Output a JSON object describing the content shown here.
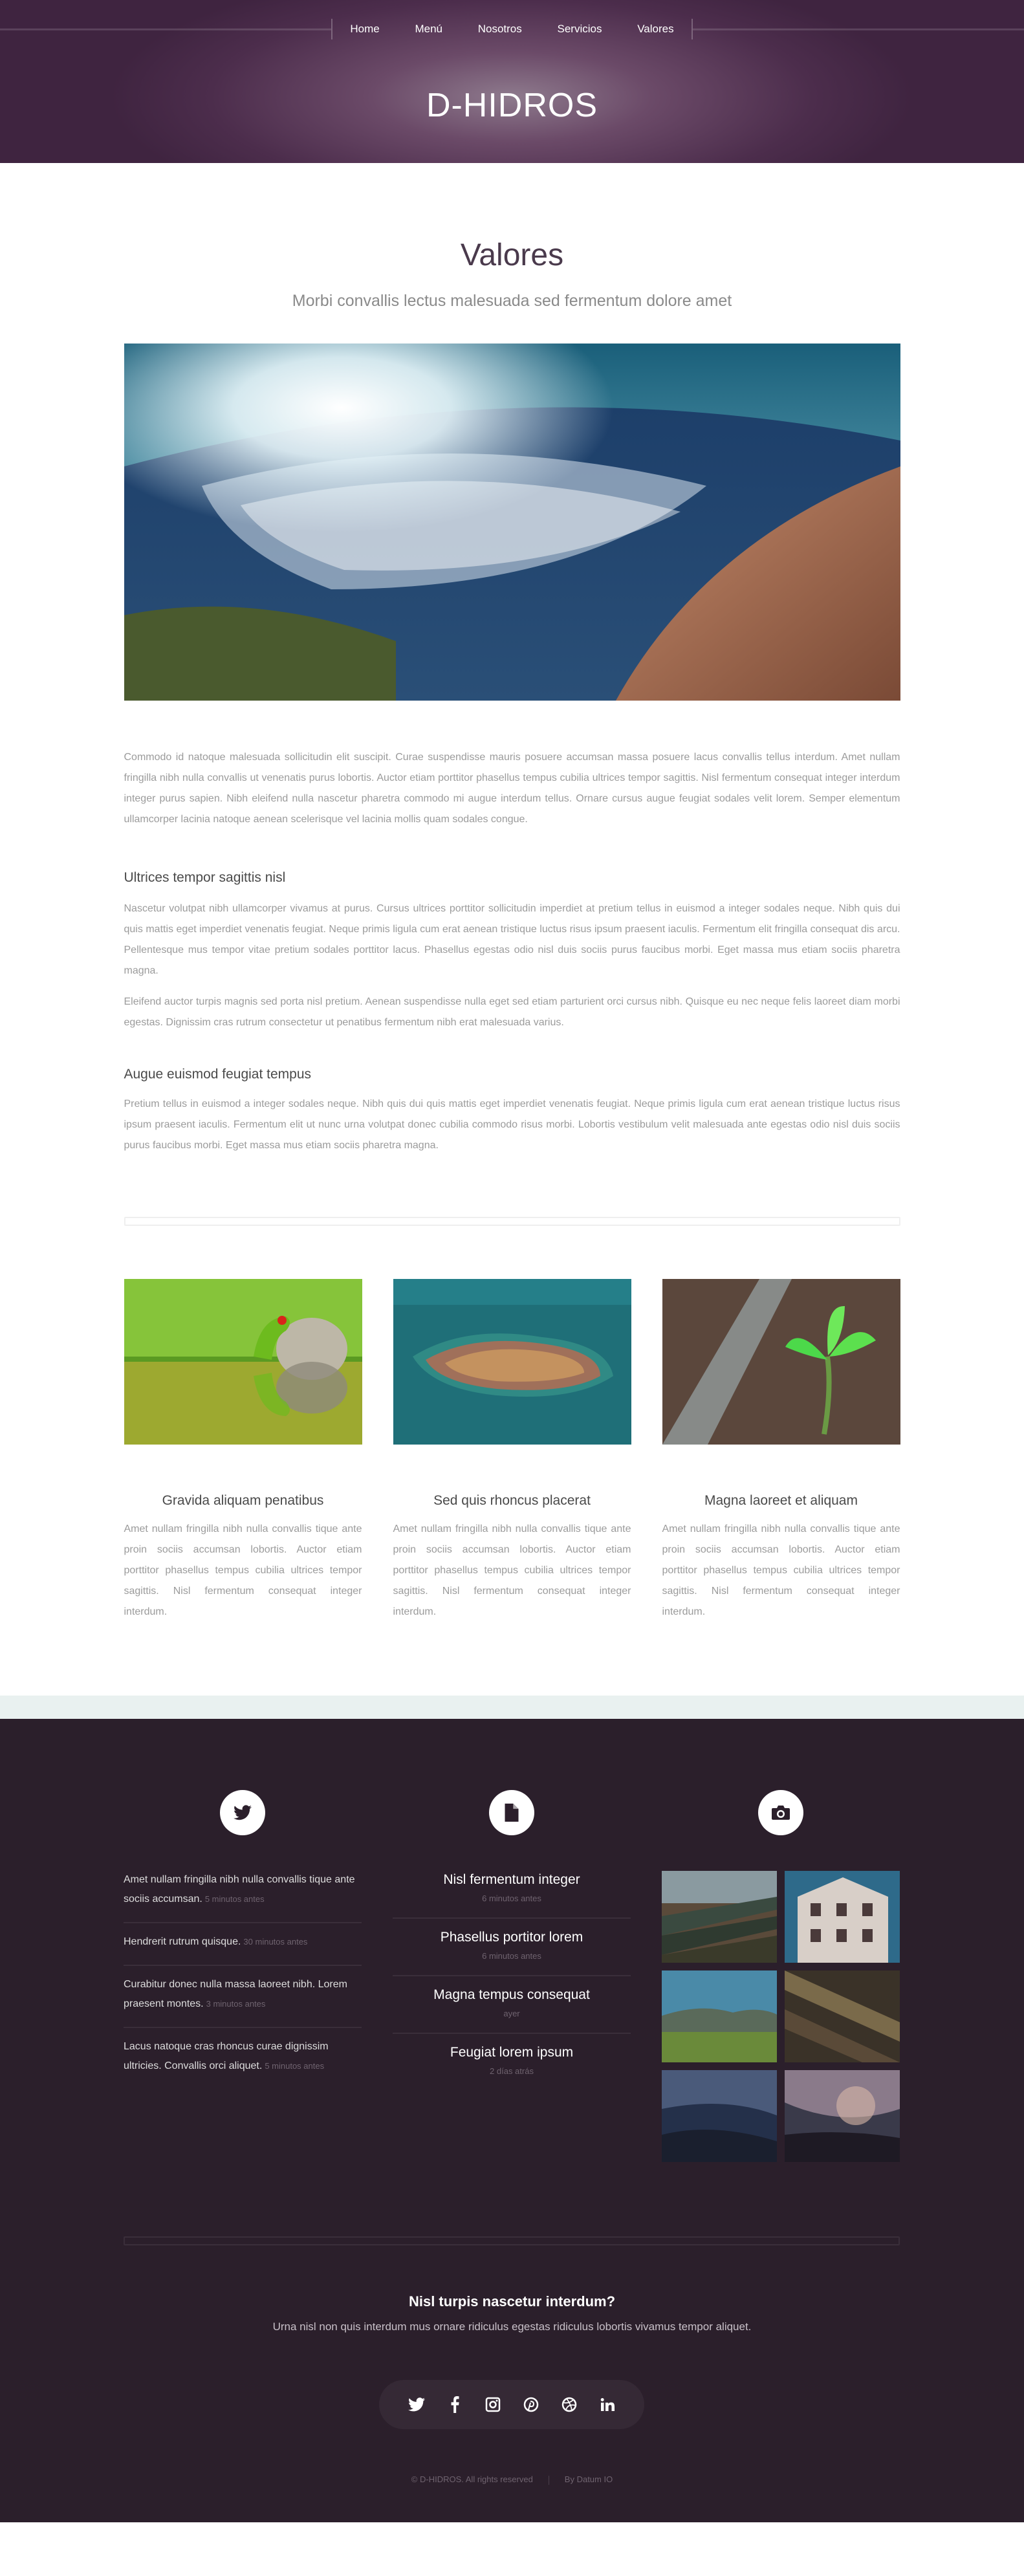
{
  "nav": {
    "items": [
      "Home",
      "Menú",
      "Nosotros",
      "Servicios",
      "Valores"
    ]
  },
  "site": {
    "title": "D-HIDROS"
  },
  "page": {
    "title": "Valores",
    "subtitle": "Morbi convallis lectus malesuada sed fermentum dolore amet"
  },
  "content": {
    "p1": "Commodo id natoque malesuada sollicitudin elit suscipit. Curae suspendisse mauris posuere accumsan massa posuere lacus convallis tellus interdum. Amet nullam fringilla nibh nulla convallis ut venenatis purus lobortis. Auctor etiam porttitor phasellus tempus cubilia ultrices tempor sagittis. Nisl fermentum consequat integer interdum integer purus sapien. Nibh eleifend nulla nascetur pharetra commodo mi augue interdum tellus. Ornare cursus augue feugiat sodales velit lorem. Semper elementum ullamcorper lacinia natoque aenean scelerisque vel lacinia mollis quam sodales congue.",
    "h1": "Ultrices tempor sagittis nisl",
    "p2": "Nascetur volutpat nibh ullamcorper vivamus at purus. Cursus ultrices porttitor sollicitudin imperdiet at pretium tellus in euismod a integer sodales neque. Nibh quis dui quis mattis eget imperdiet venenatis feugiat. Neque primis ligula cum erat aenean tristique luctus risus ipsum praesent iaculis. Fermentum elit fringilla consequat dis arcu. Pellentesque mus tempor vitae pretium sodales porttitor lacus. Phasellus egestas odio nisl duis sociis purus faucibus morbi. Eget massa mus etiam sociis pharetra magna.",
    "p3": "Eleifend auctor turpis magnis sed porta nisl pretium. Aenean suspendisse nulla eget sed etiam parturient orci cursus nibh. Quisque eu nec neque felis laoreet diam morbi egestas. Dignissim cras rutrum consectetur ut penatibus fermentum nibh erat malesuada varius.",
    "h2": "Augue euismod feugiat tempus",
    "p4": "Pretium tellus in euismod a integer sodales neque. Nibh quis dui quis mattis eget imperdiet venenatis feugiat. Neque primis ligula cum erat aenean tristique luctus risus ipsum praesent iaculis. Fermentum elit ut nunc urna volutpat donec cubilia commodo risus morbi. Lobortis vestibulum velit malesuada ante egestas odio nisl duis sociis purus faucibus morbi. Eget massa mus etiam sociis pharetra magna."
  },
  "features": [
    {
      "title": "Gravida aliquam penatibus",
      "text": "Amet nullam fringilla nibh nulla convallis tique ante proin sociis accumsan lobortis. Auctor etiam porttitor phasellus tempus cubilia ultrices tempor sagittis. Nisl fermentum consequat integer interdum."
    },
    {
      "title": "Sed quis rhoncus placerat",
      "text": "Amet nullam fringilla nibh nulla convallis tique ante proin sociis accumsan lobortis. Auctor etiam porttitor phasellus tempus cubilia ultrices tempor sagittis. Nisl fermentum consequat integer interdum."
    },
    {
      "title": "Magna laoreet et aliquam",
      "text": "Amet nullam fringilla nibh nulla convallis tique ante proin sociis accumsan lobortis. Auctor etiam porttitor phasellus tempus cubilia ultrices tempor sagittis. Nisl fermentum consequat integer interdum."
    }
  ],
  "footer": {
    "icons": [
      "twitter-icon",
      "document-icon",
      "camera-icon"
    ],
    "tweets": [
      {
        "text": "Amet nullam fringilla nibh nulla convallis tique ante sociis accumsan.",
        "ago": "5 minutos antes"
      },
      {
        "text": "Hendrerit rutrum quisque.",
        "ago": "30 minutos antes"
      },
      {
        "text": "Curabitur donec nulla massa laoreet nibh. Lorem praesent montes.",
        "ago": "3 minutos antes"
      },
      {
        "text": "Lacus natoque cras rhoncus curae dignissim ultricies. Convallis orci aliquet.",
        "ago": "5 minutos antes"
      }
    ],
    "posts": [
      {
        "title": "Nisl fermentum integer",
        "date": "6 minutos antes"
      },
      {
        "title": "Phasellus portitor lorem",
        "date": "6 minutos antes"
      },
      {
        "title": "Magna tempus consequat",
        "date": "ayer"
      },
      {
        "title": "Feugiat lorem ipsum",
        "date": "2 días atrás"
      }
    ],
    "cta_title": "Nisl turpis nascetur interdum?",
    "cta_text": "Urna nisl non quis interdum mus ornare ridiculus egestas ridiculus lobortis vivamus tempor aliquet.",
    "social": [
      "twitter-icon",
      "facebook-icon",
      "instagram-icon",
      "pinterest-icon",
      "dribbble-icon",
      "linkedin-icon"
    ],
    "copyright": "© D-HIDROS. All rights reserved",
    "credit": "By Datum IO"
  },
  "colors": {
    "header": "#4a2e4c",
    "footer": "#2b1f2b",
    "band": "#e9f1f0",
    "title": "#4a3a4c"
  }
}
